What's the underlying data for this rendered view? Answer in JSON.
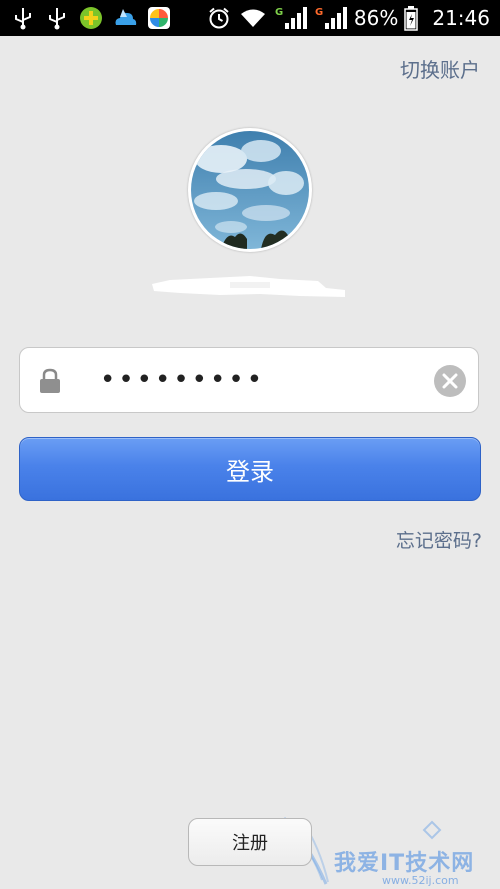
{
  "status_bar": {
    "icons_left": [
      "usb-icon",
      "usb-icon",
      "app-green-plus-icon",
      "weather-cloud-icon",
      "app-colorful-icon"
    ],
    "icons_right": [
      "alarm-icon",
      "wifi-icon",
      "signal-g-icon",
      "signal-g-icon",
      "battery-icon"
    ],
    "battery": "86%",
    "time": "21:46",
    "network_label": "G"
  },
  "header": {
    "switch_account": "切换账户"
  },
  "login": {
    "password_value": "•••••••••",
    "login_button": "登录",
    "forgot_password": "忘记密码?",
    "register_button": "注册"
  },
  "watermark": {
    "text": "我爱IT技术网",
    "sub": "www.52ij.com"
  },
  "colors": {
    "background": "#e9e9e9",
    "link": "#5c6f8c",
    "primary_button": "#4a82ea"
  }
}
